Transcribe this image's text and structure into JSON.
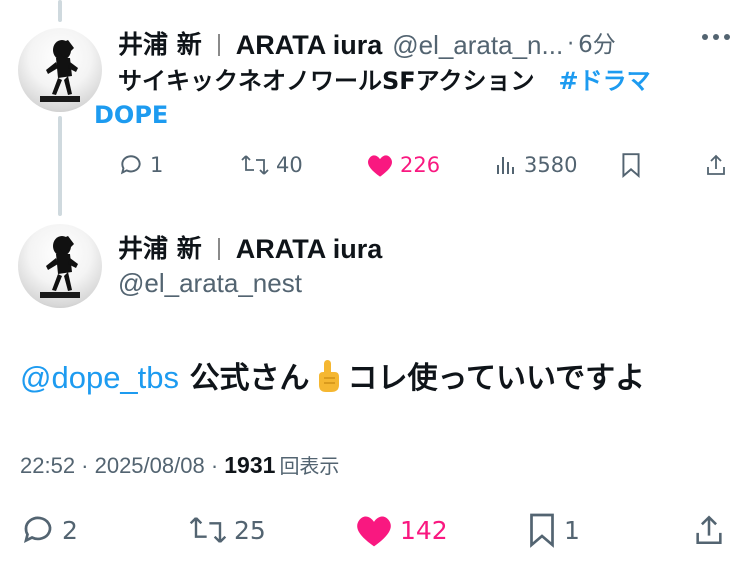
{
  "tweet_quoted": {
    "display_name_jp": "井浦 新",
    "display_name_en": "ARATA iura",
    "handle": "@el_arata_n...",
    "dot": "·",
    "time": "6分",
    "text": "サイキックネオノワールSFアクション",
    "hashtag": "#ドラマ",
    "hashtag_cont": "DOPE",
    "actions": {
      "replies": "1",
      "retweets": "40",
      "likes": "226",
      "views": "3580"
    }
  },
  "tweet_main": {
    "display_name_jp": "井浦 新",
    "display_name_en": "ARATA iura",
    "handle": "@el_arata_nest",
    "mention": "@dope_tbs",
    "text_before_emoji": "公式さん",
    "text_after_emoji": "コレ使っていいですよ",
    "emoji": "point-up-hand",
    "timestamp": "22:52 · 2025/08/08 · ",
    "view_count": "1931",
    "view_label": "回表示",
    "actions": {
      "replies": "2",
      "retweets": "25",
      "likes": "142",
      "bookmarks": "1"
    }
  },
  "colors": {
    "accent_blue": "#1d9bf0",
    "like_pink": "#f91880",
    "muted": "#536471"
  },
  "icons": [
    "more-dots-icon",
    "reply-icon",
    "retweet-icon",
    "heart-icon",
    "views-icon",
    "bookmark-icon",
    "share-icon"
  ]
}
